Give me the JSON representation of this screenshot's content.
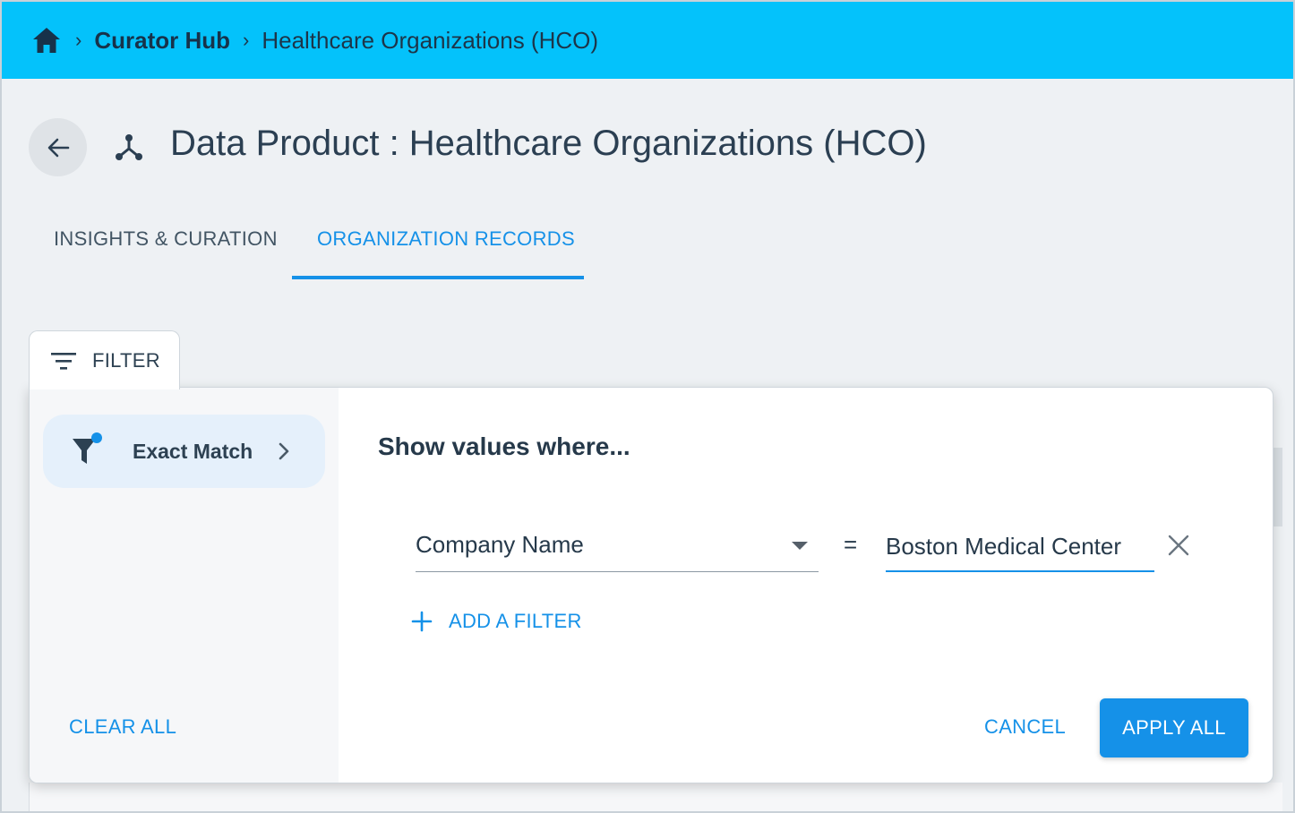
{
  "breadcrumb": {
    "home_icon": "home-icon",
    "items": [
      "Curator Hub",
      "Healthcare Organizations (HCO)"
    ],
    "separator": "›"
  },
  "header": {
    "back_icon": "arrow-left-icon",
    "product_icon": "data-product-icon",
    "title": "Data Product : Healthcare Organizations (HCO)"
  },
  "tabs": [
    {
      "label": "INSIGHTS & CURATION",
      "active": false
    },
    {
      "label": "ORGANIZATION RECORDS",
      "active": true
    }
  ],
  "filter_tab": {
    "label": "FILTER",
    "icon": "filter-lines-icon"
  },
  "filter_panel": {
    "mode": {
      "label": "Exact Match",
      "icon": "funnel-icon"
    },
    "clear_all_label": "CLEAR ALL",
    "heading": "Show values where...",
    "condition": {
      "field": "Company Name",
      "operator": "=",
      "value": "Boston Medical Center"
    },
    "add_filter_label": "ADD A FILTER",
    "cancel_label": "CANCEL",
    "apply_label": "APPLY ALL"
  },
  "colors": {
    "topbar": "#04c2fb",
    "accent": "#1591e8",
    "background": "#eef1f4"
  }
}
